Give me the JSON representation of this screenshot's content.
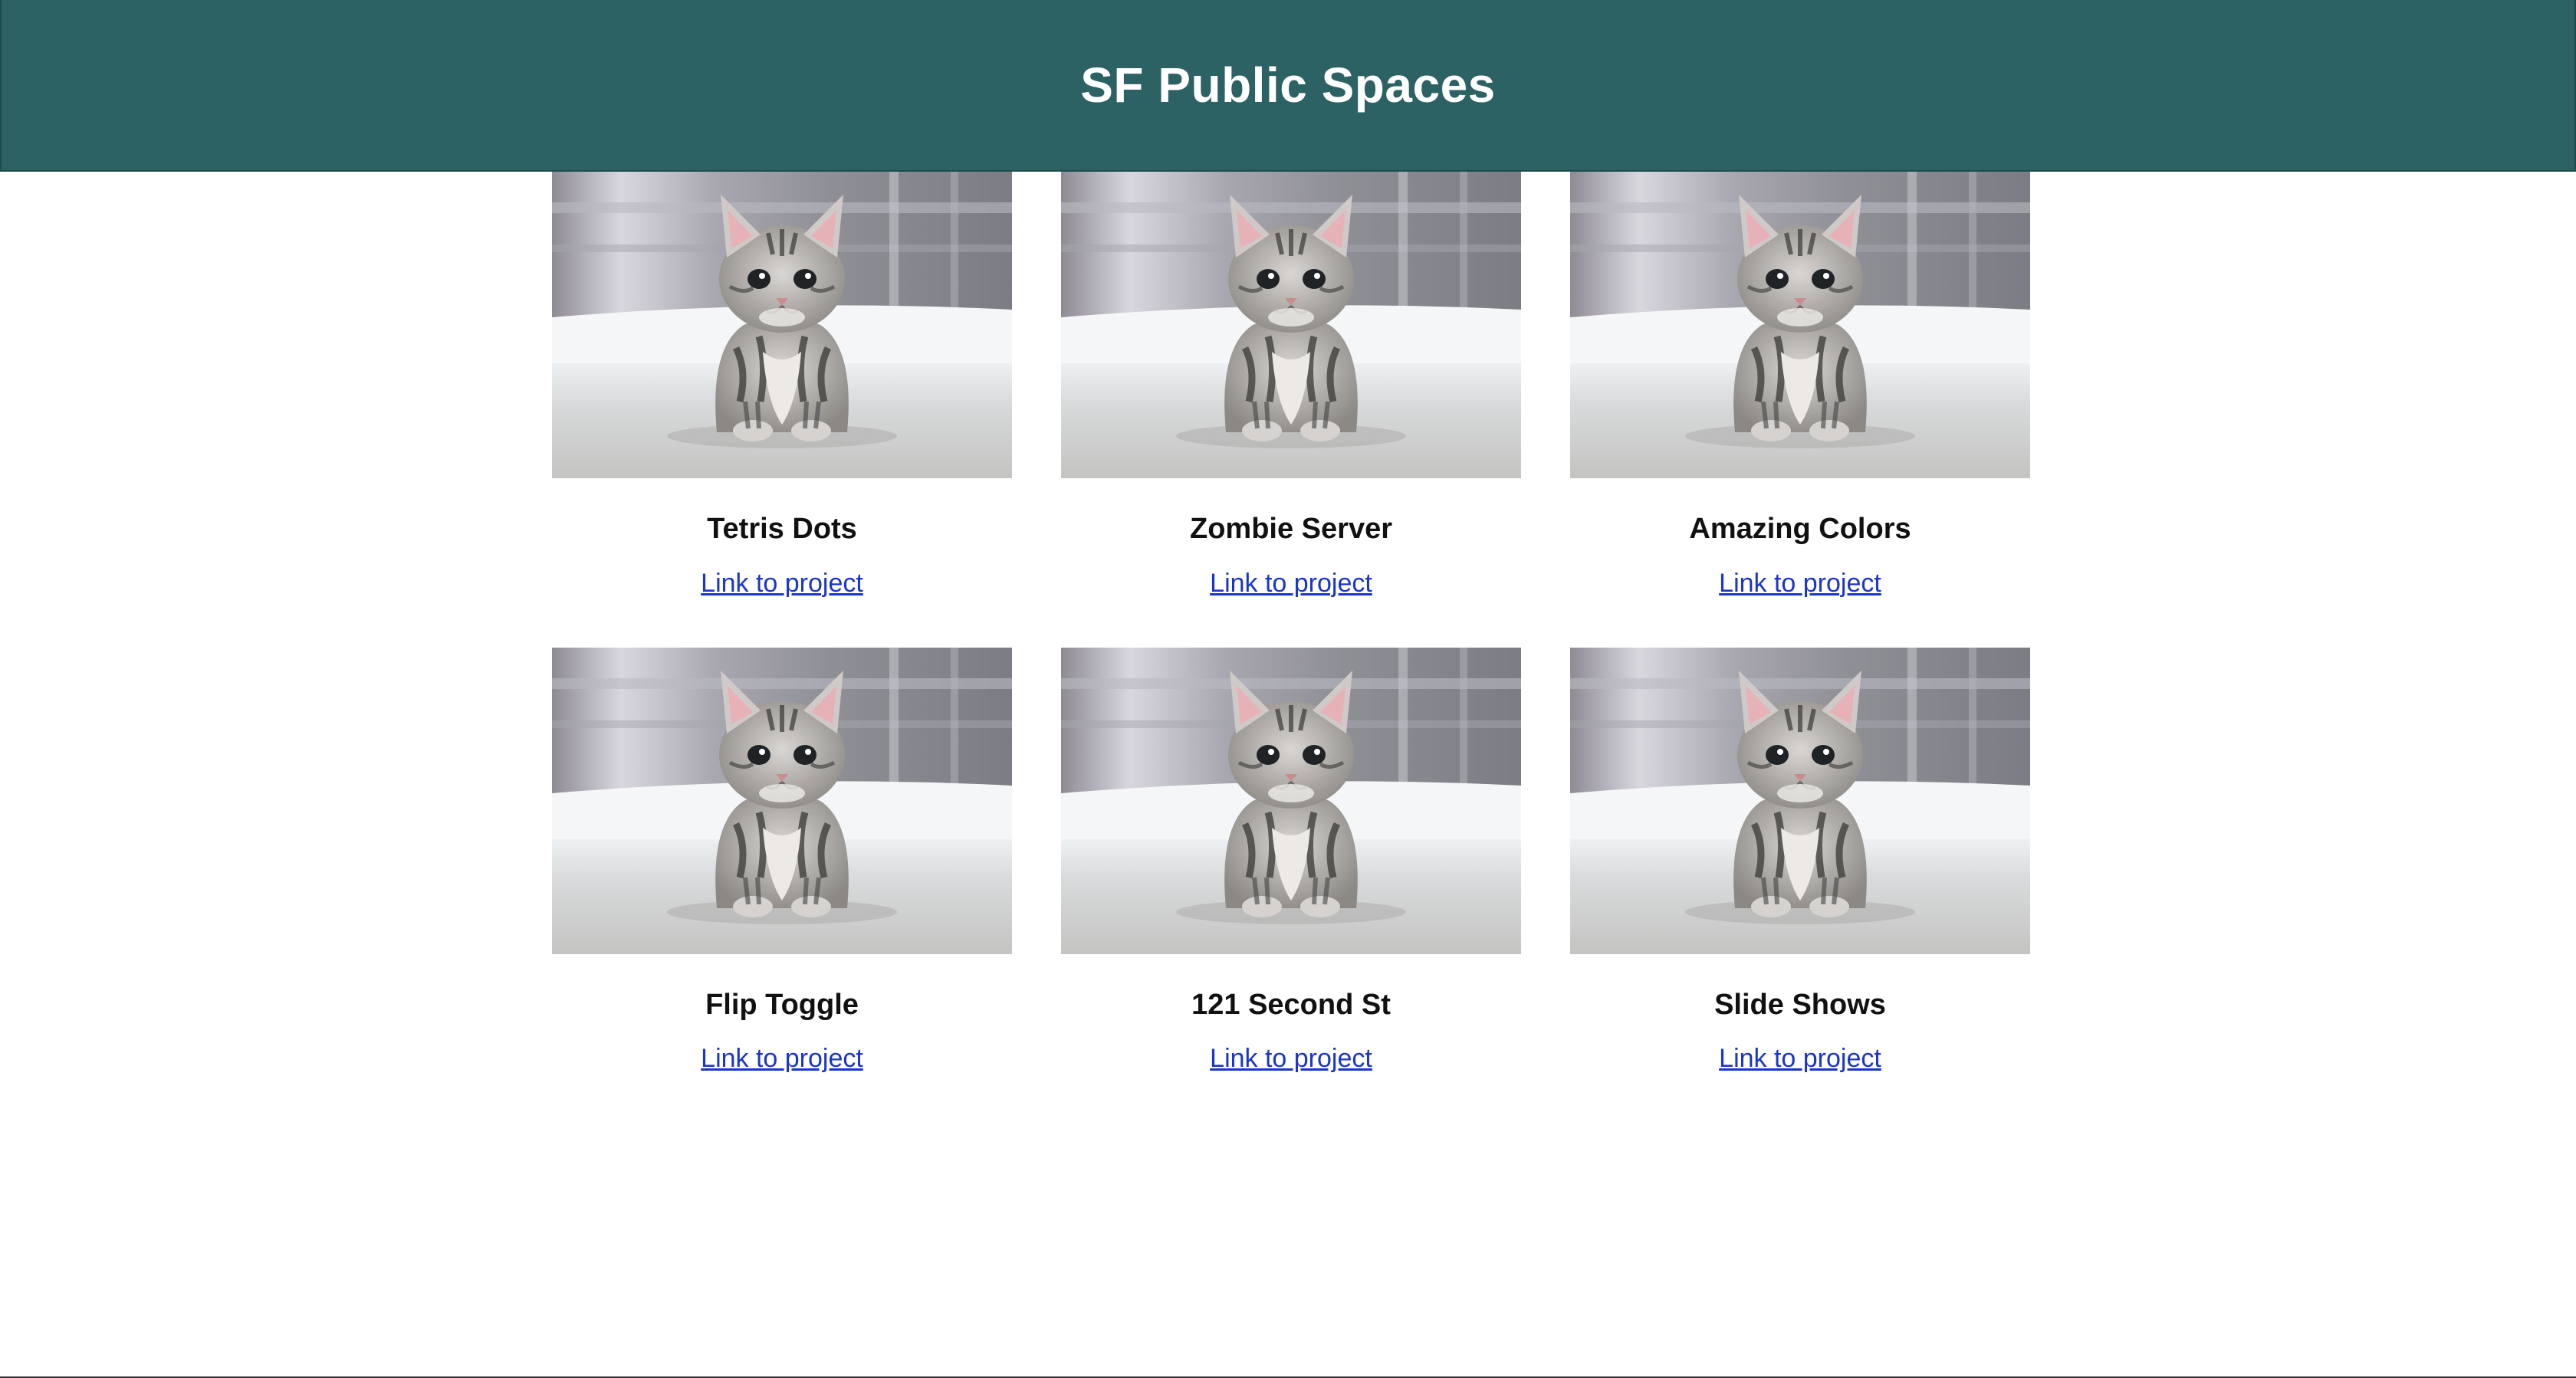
{
  "header": {
    "title": "SF Public Spaces"
  },
  "colors": {
    "header_bg": "#2c6264",
    "link": "#1a36c9"
  },
  "projects": [
    {
      "title": "Tetris Dots",
      "link_label": "Link to project",
      "image": "kitten-photo"
    },
    {
      "title": "Zombie Server",
      "link_label": "Link to project",
      "image": "kitten-photo"
    },
    {
      "title": "Amazing Colors",
      "link_label": "Link to project",
      "image": "kitten-photo"
    },
    {
      "title": "Flip Toggle",
      "link_label": "Link to project",
      "image": "kitten-photo"
    },
    {
      "title": "121 Second St",
      "link_label": "Link to project",
      "image": "kitten-photo"
    },
    {
      "title": "Slide Shows",
      "link_label": "Link to project",
      "image": "kitten-photo"
    }
  ]
}
